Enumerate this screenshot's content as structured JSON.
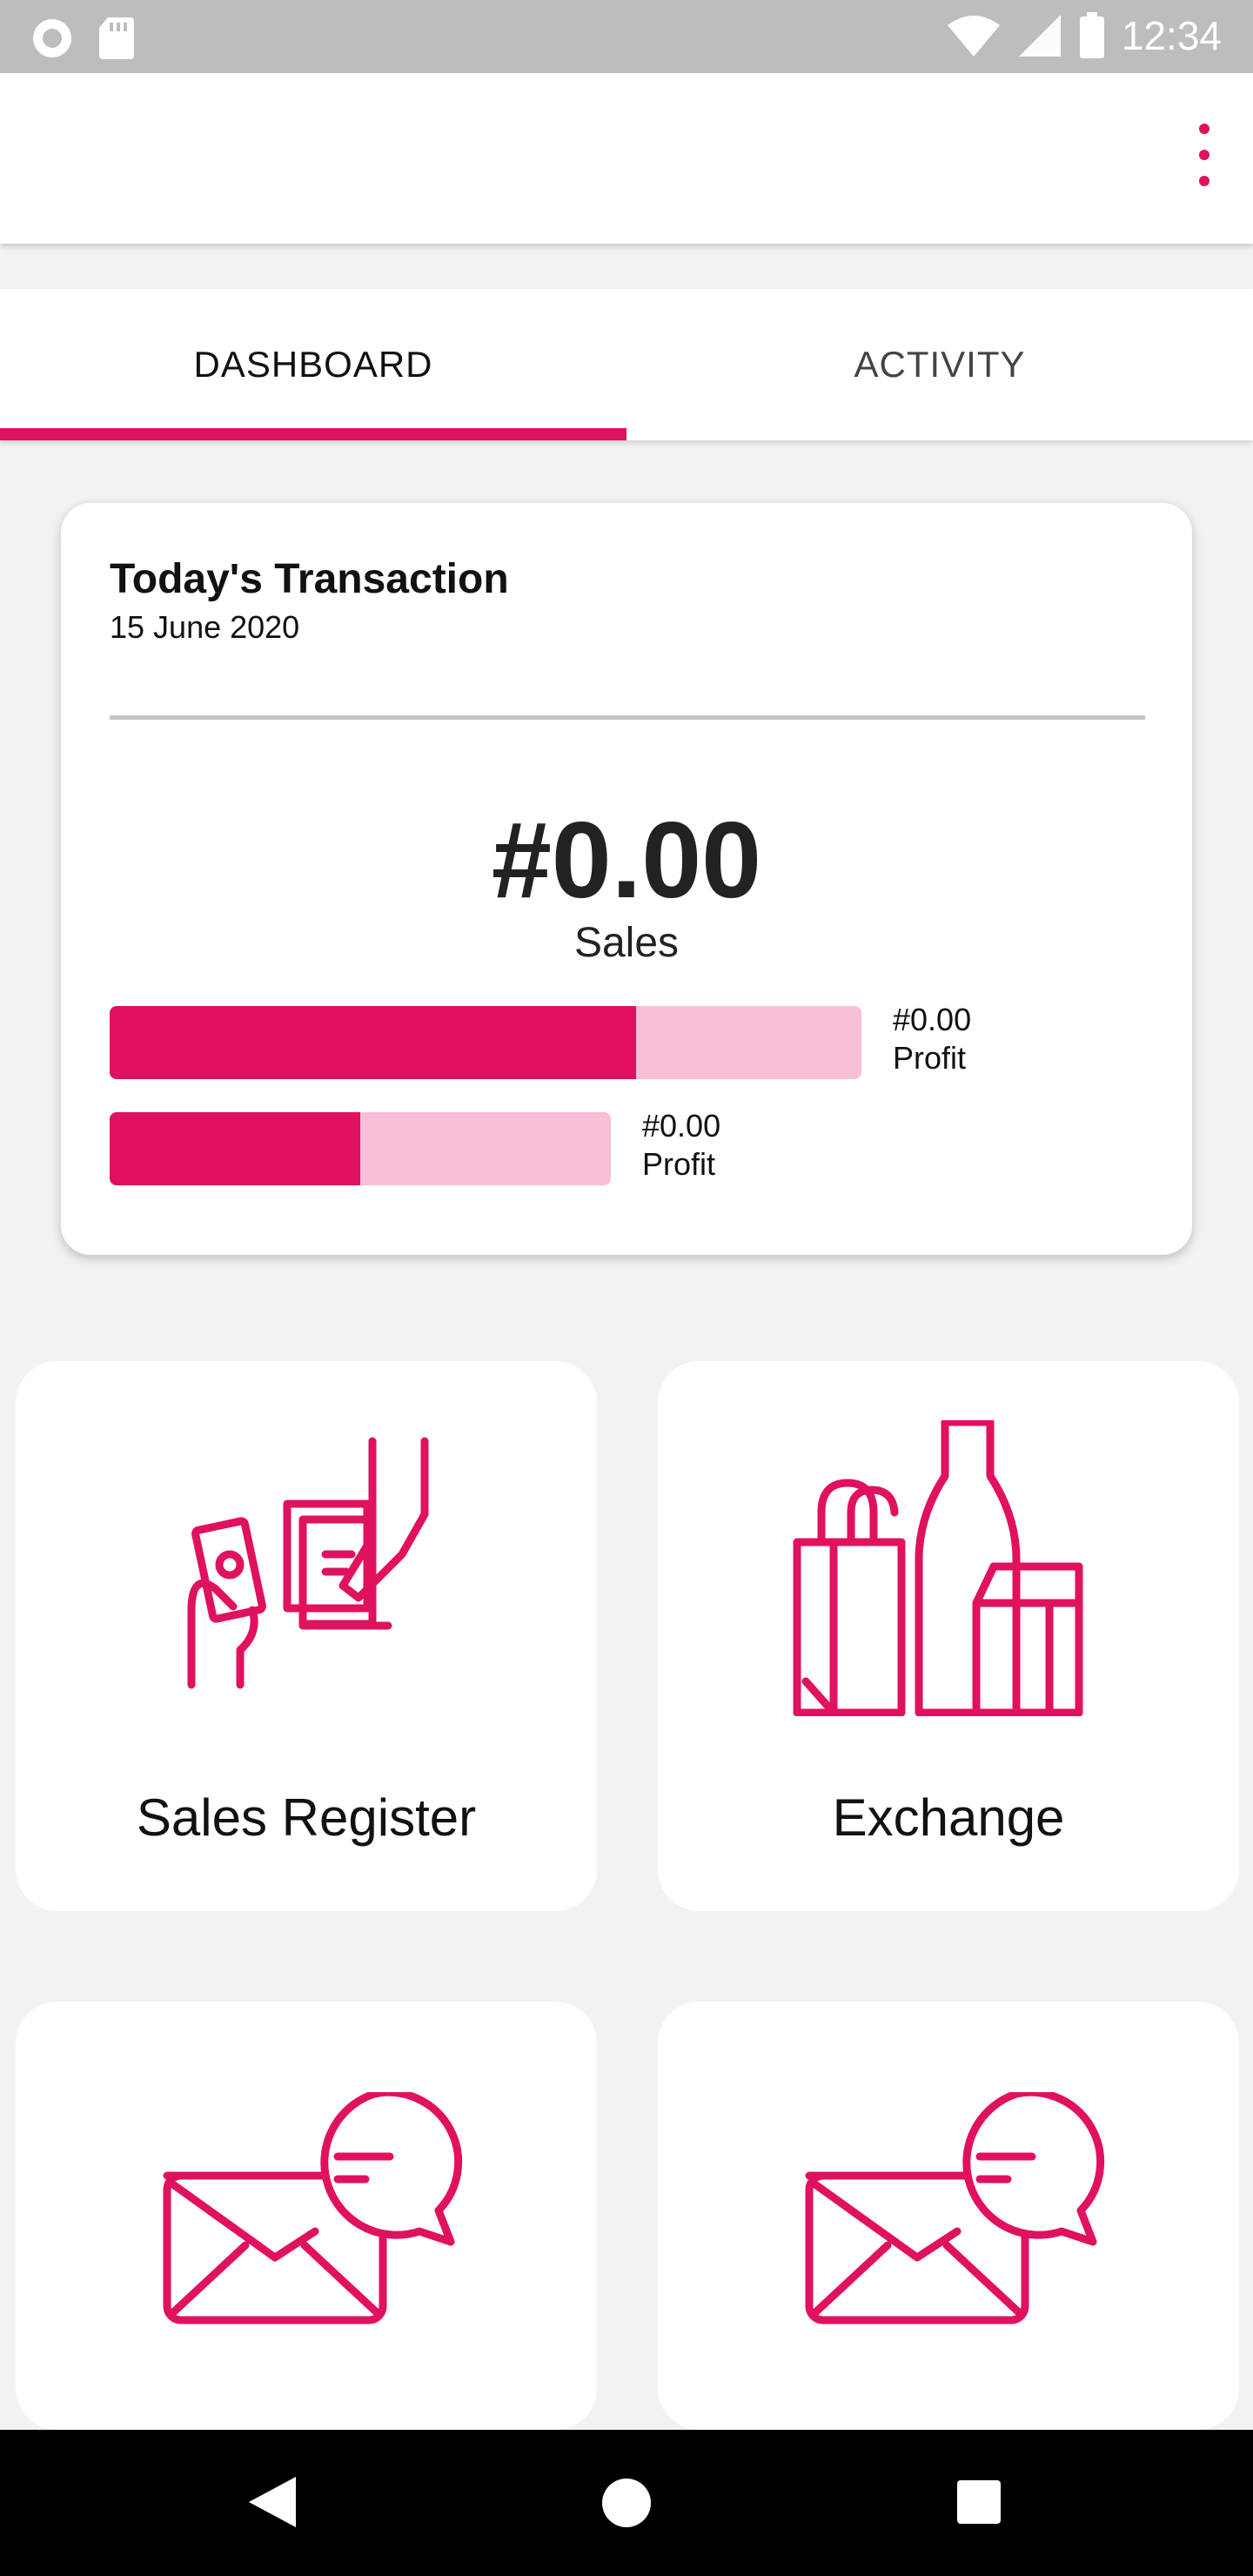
{
  "status_bar": {
    "time": "12:34",
    "icons": [
      "record-icon",
      "sd-card-icon",
      "wifi-icon",
      "signal-icon",
      "battery-icon"
    ]
  },
  "app_bar": {
    "menu_icon": "more-vert-icon"
  },
  "tabs": [
    {
      "label": "DASHBOARD",
      "active": true
    },
    {
      "label": "ACTIVITY",
      "active": false
    }
  ],
  "transaction_card": {
    "title": "Today's Transaction",
    "date": "15 June 2020",
    "amount": "#0.00",
    "amount_label": "Sales",
    "bars": [
      {
        "value": "#0.00",
        "label": "Profit",
        "fill_fraction": 0.7
      },
      {
        "value": "#0.00",
        "label": "Profit",
        "fill_fraction": 0.5
      }
    ]
  },
  "tiles": [
    {
      "label": "Sales Register",
      "icon": "payment-hand-icon"
    },
    {
      "label": "Exchange",
      "icon": "groceries-icon"
    },
    {
      "label": "",
      "icon": "mail-chat-icon"
    },
    {
      "label": "",
      "icon": "mail-chat-icon"
    }
  ],
  "nav_bar": {
    "icons": [
      "back-icon",
      "home-icon",
      "recents-icon"
    ]
  },
  "colors": {
    "accent": "#e0115f",
    "accent_light": "#f7c0d6",
    "status_bar": "#bdbdbd",
    "background": "#f2f2f2"
  }
}
